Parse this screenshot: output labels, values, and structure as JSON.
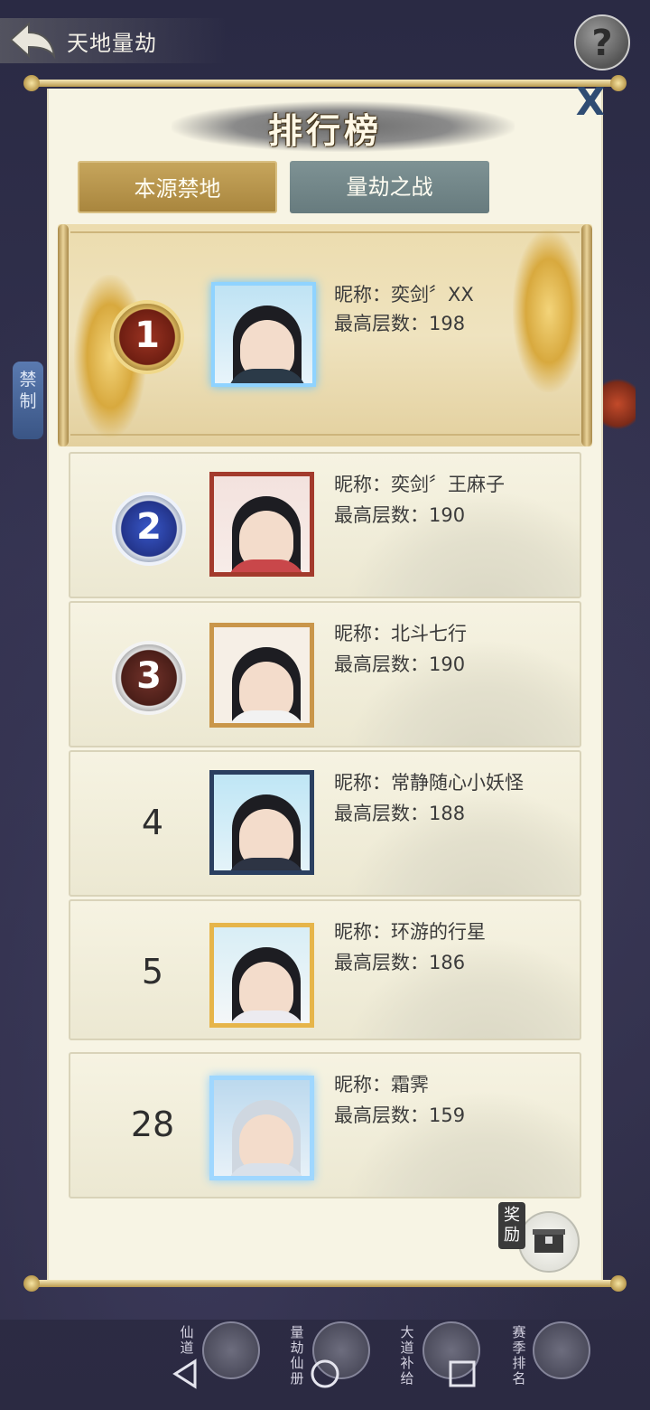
{
  "header": {
    "title": "天地量劫",
    "help_label": "?"
  },
  "side": {
    "left_tab": "禁制"
  },
  "panel": {
    "title": "排行榜",
    "close_label": "X",
    "tabs": [
      {
        "label": "本源禁地",
        "active": true
      },
      {
        "label": "量劫之战",
        "active": false
      }
    ]
  },
  "rankings": [
    {
      "rank": "1",
      "nickname": "昵称：奕剑〞XX",
      "floor": "最高层数：198"
    },
    {
      "rank": "2",
      "nickname": "昵称：奕剑〞王麻子",
      "floor": "最高层数：190"
    },
    {
      "rank": "3",
      "nickname": "昵称：北斗七行",
      "floor": "最高层数：190"
    },
    {
      "rank": "4",
      "nickname": "昵称：常静随心小妖怪",
      "floor": "最高层数：188"
    },
    {
      "rank": "5",
      "nickname": "昵称：环游的行星",
      "floor": "最高层数：186"
    }
  ],
  "my_rank": {
    "rank": "28",
    "nickname": "昵称：霜霁",
    "floor": "最高层数：159"
  },
  "reward": {
    "label": "奖励"
  },
  "bottom_nav": [
    {
      "label": "仙道"
    },
    {
      "label": "量劫仙册"
    },
    {
      "label": "大道补给"
    },
    {
      "label": "赛季排名"
    }
  ],
  "colors": {
    "tab_active": "#b89548",
    "tab_inactive": "#71868a",
    "panel_bg": "#f7f4e4"
  }
}
